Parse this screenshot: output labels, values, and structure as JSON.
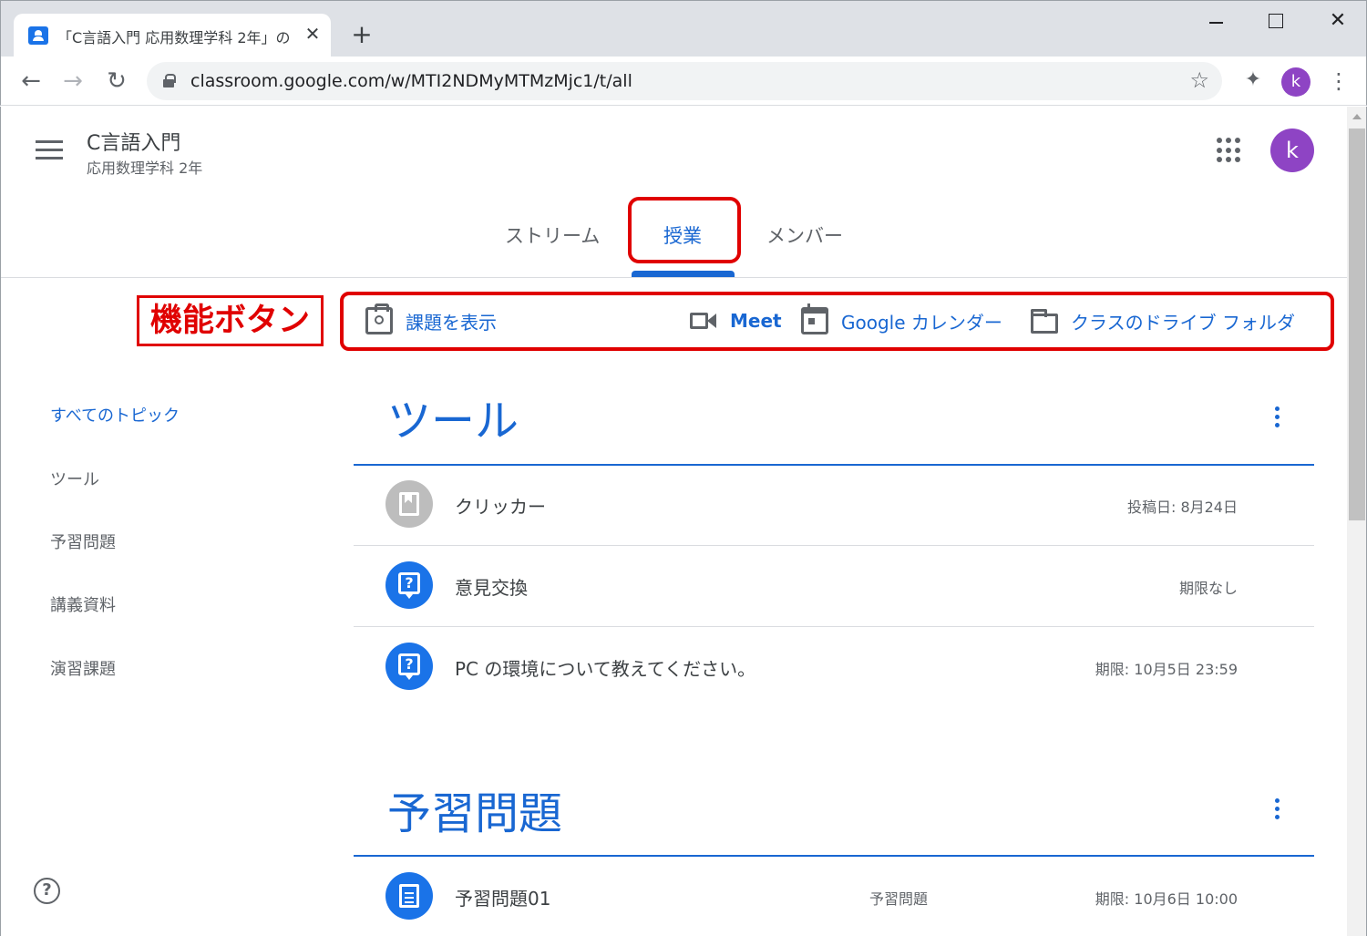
{
  "browser": {
    "tab_title": "「C言語入門 応用数理学科 2年」の",
    "tab_close": "✕",
    "new_tab": "+",
    "win_close": "✕",
    "url": "classroom.google.com/w/MTI2NDMyMTMzMjc1/t/all",
    "back": "←",
    "forward": "→",
    "reload": "↻",
    "star": "☆",
    "extensions": "✦",
    "profile_initial": "k",
    "menu": "⋮"
  },
  "header": {
    "course_title": "C言語入門",
    "course_subtitle": "応用数理学科 2年",
    "avatar_initial": "k"
  },
  "tabs": [
    {
      "label": "ストリーム",
      "active": false
    },
    {
      "label": "授業",
      "active": true
    },
    {
      "label": "メンバー",
      "active": false
    }
  ],
  "annotation": {
    "feature_label": "機能ボタン",
    "highlight_color": "#e00000"
  },
  "feature_buttons": {
    "view_assignments": "課題を表示",
    "meet": "Meet",
    "calendar": "Google カレンダー",
    "drive_folder": "クラスのドライブ フォルダ"
  },
  "sidebar": {
    "items": [
      {
        "label": "すべてのトピック",
        "active": true
      },
      {
        "label": "ツール",
        "active": false
      },
      {
        "label": "予習問題",
        "active": false
      },
      {
        "label": "講義資料",
        "active": false
      },
      {
        "label": "演習課題",
        "active": false
      }
    ],
    "help": "?"
  },
  "topics": [
    {
      "title": "ツール",
      "items": [
        {
          "name": "クリッカー",
          "type": "material",
          "meta": "投稿日: 8月24日"
        },
        {
          "name": "意見交換",
          "type": "question",
          "meta": "期限なし"
        },
        {
          "name": "PC の環境について教えてください。",
          "type": "question",
          "meta": "期限: 10月5日 23:59"
        }
      ]
    },
    {
      "title": "予習問題",
      "items": [
        {
          "name": "予習問題01",
          "type": "assignment",
          "topic": "予習問題",
          "meta": "期限: 10月6日 10:00"
        }
      ]
    }
  ],
  "colors": {
    "accent": "#1967d2",
    "avatar": "#8e44c4",
    "annotation_red": "#e00000"
  }
}
